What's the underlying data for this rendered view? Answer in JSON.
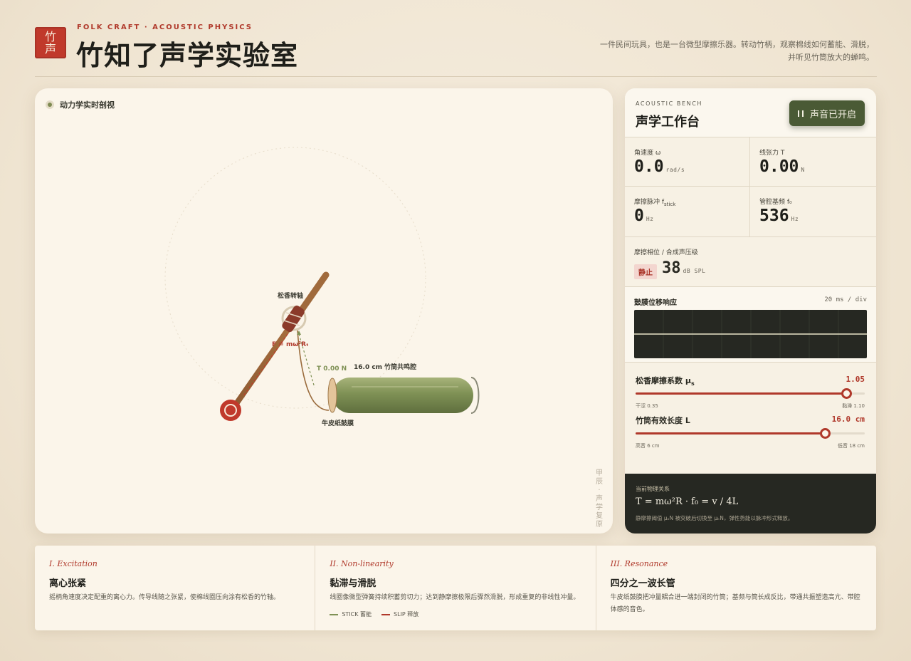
{
  "header": {
    "seal": [
      "竹",
      "声"
    ],
    "kicker": "FOLK CRAFT · ACOUSTIC PHYSICS",
    "title": "竹知了声学实验室",
    "desc_line1": "一件民间玩具，也是一台微型摩擦乐器。转动竹柄，观察棉线如何蓄能、滑脱，",
    "desc_line2": "并听见竹筒放大的蝉鸣。"
  },
  "stage": {
    "tag": "动力学实时剖视",
    "labels": {
      "axle": "松香转轴",
      "force": "F = mω²Rₜ",
      "tension": "T 0.00 N",
      "tube": "16.0 cm 竹筒共鸣腔",
      "membrane": "牛皮纸鼓膜"
    },
    "vertical": [
      "甲",
      "辰",
      "·",
      "声",
      "学",
      "复",
      "原"
    ]
  },
  "bench": {
    "kicker": "ACOUSTIC BENCH",
    "title": "声学工作台",
    "sound_button": "声音已开启",
    "metrics": [
      {
        "label": "角速度 ω",
        "value": "0.0",
        "unit": "rad/s"
      },
      {
        "label": "线张力 T",
        "value": "0.00",
        "unit": "N"
      },
      {
        "label": "摩擦脉冲 f",
        "sub": "stick",
        "value": "0",
        "unit": "Hz"
      },
      {
        "label": "管腔基频 f₀",
        "value": "536",
        "unit": "Hz"
      }
    ],
    "phase": {
      "label": "摩擦相位 / 合成声压级",
      "state": "静止",
      "value": "38",
      "unit": "dB SPL"
    },
    "scope": {
      "title": "鼓膜位移响应",
      "division": "20 ms / div"
    },
    "sliders": [
      {
        "label": "松香摩擦系数 μ",
        "label_sub": "s",
        "value": "1.05",
        "min_label": "干涩 0.35",
        "max_label": "黏滞 1.10",
        "fraction": 0.92
      },
      {
        "label": "竹筒有效长度 L",
        "value": "16.0 cm",
        "min_label": "高音 6 cm",
        "max_label": "低音 18 cm",
        "fraction": 0.83
      }
    ],
    "physics": {
      "label": "当前物理关系",
      "formula": "T = mω²R  ·  f₀ = v / 4L",
      "note": "静摩擦阈值 μₛN 被突破后切换至 μₖN，弹性势能以脉冲形式释放。"
    }
  },
  "cards": [
    {
      "kicker": "I. Excitation",
      "title": "离心张紧",
      "body": "摇柄角速度决定配重的离心力。传导线随之张紧，使棉线圈压向涂有松香的竹轴。"
    },
    {
      "kicker": "II. Non-linearity",
      "title": "黏滞与滑脱",
      "body": "线圈像微型弹簧持续积蓄剪切力；达到静摩擦极限后骤然滑脱，形成重复的非线性冲量。",
      "legend": [
        "STICK 蓄能",
        "SLIP 释放"
      ]
    },
    {
      "kicker": "III. Resonance",
      "title": "四分之一波长管",
      "body": "牛皮纸鼓膜把冲量耦合进一端封闭的竹筒；基频与筒长成反比，带通共振塑造高亢、带腔体感的音色。"
    }
  ],
  "colors": {
    "accent": "#b0392b",
    "bamboo": "#7f9155",
    "dark": "#262822",
    "green_button": "#4a5a35"
  }
}
